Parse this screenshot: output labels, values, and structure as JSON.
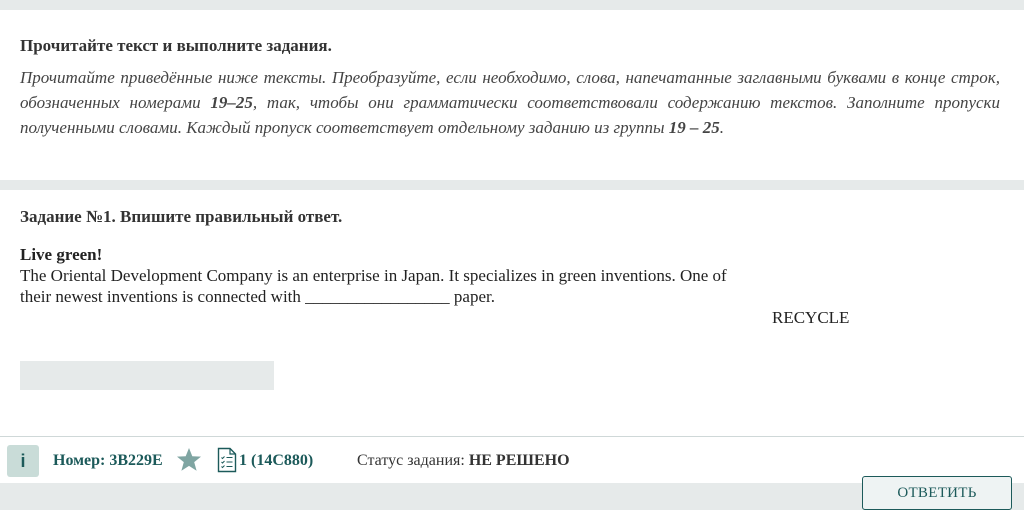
{
  "instructions": {
    "title": "Прочитайте текст и выполните задания.",
    "text_part1": "Прочитайте приведённые ниже тексты. Преобразуйте, если необходимо, слова, напечатанные заглавными буквами в конце строк, обозначенных номерами ",
    "range1": "19–25",
    "text_part2": ", так, чтобы они грамматически соответствовали содержанию текстов. Заполните пропуски полученными словами. Каждый пропуск соответствует отдельному заданию из группы ",
    "range2": "19 – 25",
    "text_part3": "."
  },
  "task": {
    "title": "Задание №1. Впишите правильный ответ.",
    "text_title": "Live green!",
    "line1": "The Oriental Development Company is an enterprise in  Japan. It specializes in green inventions. One of",
    "line2_before": "their newest inventions is connected with ",
    "blank": "_________________",
    "line2_after": " paper.",
    "keyword": "RECYCLE",
    "answer_value": ""
  },
  "footer": {
    "info_label": "i",
    "number_label": "Номер:",
    "number_value": "3B229E",
    "doc_label": "1 (14C880)",
    "status_label": "Статус задания:",
    "status_value": "НЕ РЕШЕНО",
    "submit_label": "ОТВЕТИТЬ"
  },
  "colors": {
    "accent": "#1c5a5a",
    "star": "#7fa5a2",
    "background": "#e6eaea"
  }
}
